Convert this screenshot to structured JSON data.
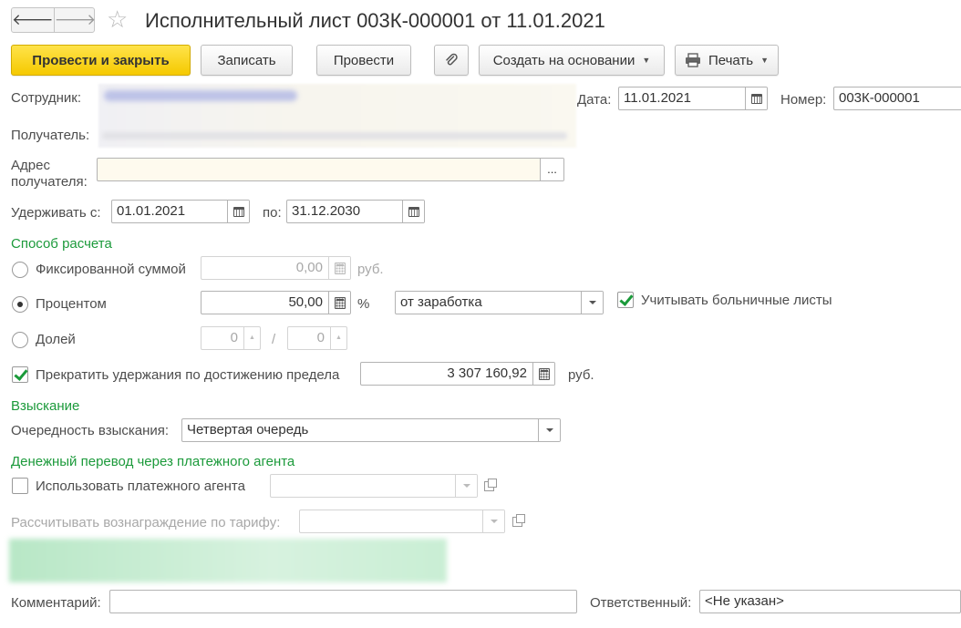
{
  "window": {
    "title": "Исполнительный лист 003К-000001 от 11.01.2021"
  },
  "toolbar": {
    "post_close_label": "Провести и закрыть",
    "save_label": "Записать",
    "post_label": "Провести",
    "create_based_label": "Создать на основании",
    "print_label": "Печать"
  },
  "header": {
    "employee_label": "Сотрудник:",
    "date_label": "Дата:",
    "date_value": "11.01.2021",
    "number_label": "Номер:",
    "number_value": "003К-000001",
    "recipient_label": "Получатель:",
    "address_label_1": "Адрес",
    "address_label_2": "получателя:",
    "address_value": "",
    "address_select_label": "...",
    "withhold_from_label": "Удерживать с:",
    "withhold_from_value": "01.01.2021",
    "withhold_to_label": "по:",
    "withhold_to_value": "31.12.2030"
  },
  "calc_method": {
    "section_title": "Способ расчета",
    "fixed_label": "Фиксированной суммой",
    "fixed_value": "0,00",
    "fixed_unit": "руб.",
    "percent_label": "Процентом",
    "percent_value": "50,00",
    "percent_unit": "%",
    "percent_base_value": "от заработка",
    "sick_leave_label": "Учитывать больничные листы",
    "sick_leave_checked": true,
    "share_label": "Долей",
    "share_numerator": "0",
    "share_separator": "/",
    "share_denominator": "0",
    "selected": "percent",
    "limit_label": "Прекратить удержания по достижению предела",
    "limit_checked": true,
    "limit_value": "3 307 160,92",
    "limit_unit": "руб."
  },
  "recovery": {
    "section_title": "Взыскание",
    "priority_label": "Очередность взыскания:",
    "priority_value": "Четвертая очередь"
  },
  "payment_agent": {
    "section_title": "Денежный перевод через платежного агента",
    "use_agent_label": "Использовать платежного агента",
    "use_agent_checked": false,
    "tariff_label": "Рассчитывать вознаграждение по тарифу:"
  },
  "footer": {
    "comment_label": "Комментарий:",
    "comment_value": "",
    "responsible_label": "Ответственный:",
    "responsible_value": "<Не указан>"
  },
  "colors": {
    "accent_yellow": "#f5c900",
    "section_green": "#1c9a3b",
    "check_green": "#1a9a3a",
    "required_field_bg": "#fefaee"
  },
  "icons": [
    "arrow-left-icon",
    "arrow-right-icon",
    "star-icon",
    "paperclip-icon",
    "printer-icon",
    "calendar-icon",
    "calculator-icon",
    "dropdown-arrow-icon",
    "open-icon"
  ]
}
